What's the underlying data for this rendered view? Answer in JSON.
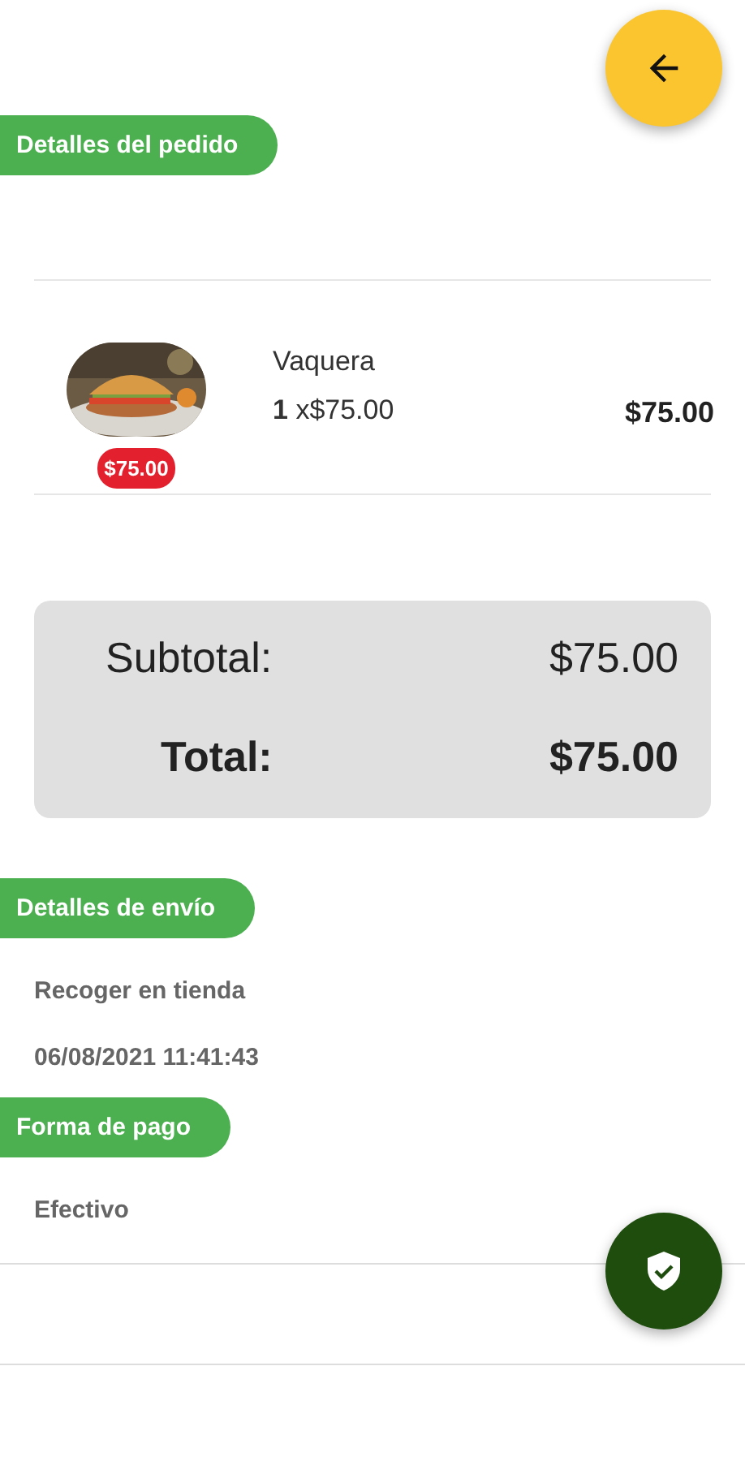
{
  "order_section": {
    "title": "Detalles del pedido"
  },
  "items": [
    {
      "kind": "picture",
      "name": "Vaquera",
      "quantity": "1",
      "unit_price": "x$75.00",
      "total": "$75.00",
      "badge": "$75.00"
    }
  ],
  "summary": {
    "subtotal_label": "Subtotal:",
    "subtotal": "$75.00",
    "total_label": "Total:",
    "total": "$75.00"
  },
  "shipping_section": {
    "title": "Detalles de envío",
    "method": "Recoger en tienda",
    "date": "06/08/2021 11:41:43"
  },
  "payment_section": {
    "title": "Forma de pago",
    "method": "Efectivo"
  }
}
